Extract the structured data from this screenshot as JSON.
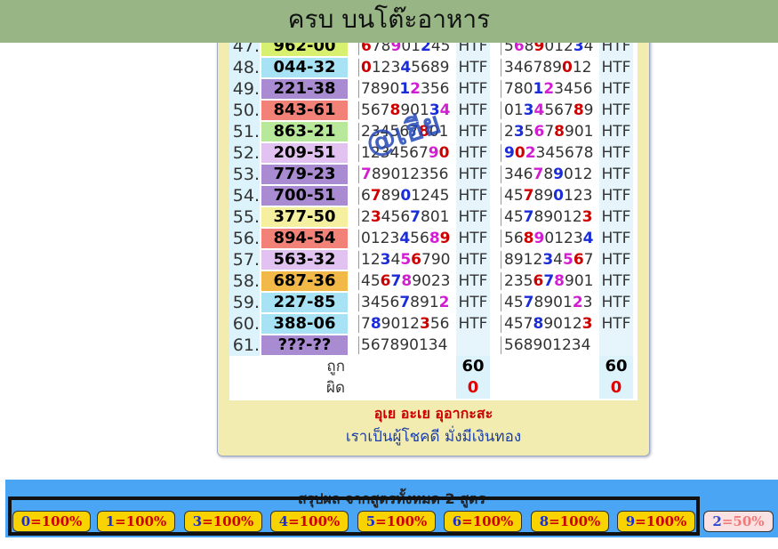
{
  "header": {
    "title": "ครบ บนโต๊ะอาหาร"
  },
  "watermark_text": "@เฮีย",
  "rows": [
    {
      "no": "47.",
      "num": "962-00",
      "bg": "#d8f070",
      "seq1": [
        [
          "6",
          "red"
        ],
        [
          "7",
          "g"
        ],
        [
          "8",
          "g"
        ],
        [
          "9",
          "pink"
        ],
        [
          "0",
          "g"
        ],
        [
          "1",
          "g"
        ],
        [
          "2",
          "blue"
        ],
        [
          "4",
          "g"
        ],
        [
          "5",
          "g"
        ]
      ],
      "htf1": "HTF",
      "seq2": [
        [
          "5",
          "g"
        ],
        [
          "6",
          "pink"
        ],
        [
          "8",
          "g"
        ],
        [
          "9",
          "red"
        ],
        [
          "0",
          "g"
        ],
        [
          "1",
          "g"
        ],
        [
          "2",
          "g"
        ],
        [
          "3",
          "blue"
        ],
        [
          "4",
          "g"
        ]
      ],
      "htf2": "HTF"
    },
    {
      "no": "48.",
      "num": "044-32",
      "bg": "#a7e3f5",
      "seq1": [
        [
          "0",
          "red"
        ],
        [
          "1",
          "g"
        ],
        [
          "2",
          "g"
        ],
        [
          "3",
          "g"
        ],
        [
          "4",
          "blue"
        ],
        [
          "5",
          "g"
        ],
        [
          "6",
          "g"
        ],
        [
          "8",
          "g"
        ],
        [
          "9",
          "g"
        ]
      ],
      "htf1": "HTF",
      "seq2": [
        [
          "3",
          "g"
        ],
        [
          "4",
          "g"
        ],
        [
          "6",
          "g"
        ],
        [
          "7",
          "g"
        ],
        [
          "8",
          "g"
        ],
        [
          "9",
          "g"
        ],
        [
          "0",
          "red"
        ],
        [
          "1",
          "g"
        ],
        [
          "2",
          "g"
        ]
      ],
      "htf2": "HTF"
    },
    {
      "no": "49.",
      "num": "221-38",
      "bg": "#a98bd2",
      "seq1": [
        [
          "7",
          "g"
        ],
        [
          "8",
          "g"
        ],
        [
          "9",
          "g"
        ],
        [
          "0",
          "g"
        ],
        [
          "1",
          "blue"
        ],
        [
          "2",
          "pink"
        ],
        [
          "3",
          "g"
        ],
        [
          "5",
          "g"
        ],
        [
          "6",
          "g"
        ]
      ],
      "htf1": "HTF",
      "seq2": [
        [
          "7",
          "g"
        ],
        [
          "8",
          "g"
        ],
        [
          "0",
          "g"
        ],
        [
          "1",
          "blue"
        ],
        [
          "2",
          "pink"
        ],
        [
          "3",
          "g"
        ],
        [
          "4",
          "g"
        ],
        [
          "5",
          "g"
        ],
        [
          "6",
          "g"
        ]
      ],
      "htf2": "HTF"
    },
    {
      "no": "50.",
      "num": "843-61",
      "bg": "#f28278",
      "seq1": [
        [
          "5",
          "g"
        ],
        [
          "6",
          "g"
        ],
        [
          "7",
          "g"
        ],
        [
          "8",
          "red"
        ],
        [
          "9",
          "g"
        ],
        [
          "0",
          "g"
        ],
        [
          "1",
          "g"
        ],
        [
          "3",
          "blue"
        ],
        [
          "4",
          "pink"
        ]
      ],
      "htf1": "HTF",
      "seq2": [
        [
          "0",
          "g"
        ],
        [
          "1",
          "g"
        ],
        [
          "3",
          "blue"
        ],
        [
          "4",
          "pink"
        ],
        [
          "5",
          "g"
        ],
        [
          "6",
          "g"
        ],
        [
          "7",
          "g"
        ],
        [
          "8",
          "red"
        ],
        [
          "9",
          "g"
        ]
      ],
      "htf2": "HTF"
    },
    {
      "no": "51.",
      "num": "863-21",
      "bg": "#b8e89a",
      "seq1": [
        [
          "2",
          "g"
        ],
        [
          "3",
          "g"
        ],
        [
          "4",
          "g"
        ],
        [
          "5",
          "g"
        ],
        [
          "6",
          "g"
        ],
        [
          "7",
          "g"
        ],
        [
          "8",
          "red"
        ],
        [
          "0",
          "g"
        ],
        [
          "1",
          "g"
        ]
      ],
      "htf1": "HTF",
      "seq2": [
        [
          "2",
          "g"
        ],
        [
          "3",
          "blue"
        ],
        [
          "5",
          "g"
        ],
        [
          "6",
          "pink"
        ],
        [
          "7",
          "g"
        ],
        [
          "8",
          "red"
        ],
        [
          "9",
          "g"
        ],
        [
          "0",
          "g"
        ],
        [
          "1",
          "g"
        ]
      ],
      "htf2": "HTF"
    },
    {
      "no": "52.",
      "num": "209-51",
      "bg": "#e2c2f0",
      "seq1": [
        [
          "1",
          "g"
        ],
        [
          "2",
          "g"
        ],
        [
          "3",
          "g"
        ],
        [
          "4",
          "g"
        ],
        [
          "5",
          "g"
        ],
        [
          "6",
          "g"
        ],
        [
          "7",
          "g"
        ],
        [
          "9",
          "pink"
        ],
        [
          "0",
          "red"
        ]
      ],
      "htf1": "HTF",
      "seq2": [
        [
          "9",
          "blue"
        ],
        [
          "0",
          "red"
        ],
        [
          "2",
          "pink"
        ],
        [
          "3",
          "g"
        ],
        [
          "4",
          "g"
        ],
        [
          "5",
          "g"
        ],
        [
          "6",
          "g"
        ],
        [
          "7",
          "g"
        ],
        [
          "8",
          "g"
        ]
      ],
      "htf2": "HTF"
    },
    {
      "no": "53.",
      "num": "779-23",
      "bg": "#a98bd2",
      "seq1": [
        [
          "7",
          "pink"
        ],
        [
          "8",
          "g"
        ],
        [
          "9",
          "g"
        ],
        [
          "0",
          "g"
        ],
        [
          "1",
          "g"
        ],
        [
          "2",
          "g"
        ],
        [
          "3",
          "g"
        ],
        [
          "5",
          "g"
        ],
        [
          "6",
          "g"
        ]
      ],
      "htf1": "HTF",
      "seq2": [
        [
          "3",
          "g"
        ],
        [
          "4",
          "g"
        ],
        [
          "6",
          "g"
        ],
        [
          "7",
          "pink"
        ],
        [
          "8",
          "g"
        ],
        [
          "9",
          "blue"
        ],
        [
          "0",
          "g"
        ],
        [
          "1",
          "g"
        ],
        [
          "2",
          "g"
        ]
      ],
      "htf2": "HTF"
    },
    {
      "no": "54.",
      "num": "700-51",
      "bg": "#a98bd2",
      "seq1": [
        [
          "6",
          "g"
        ],
        [
          "7",
          "red"
        ],
        [
          "8",
          "g"
        ],
        [
          "9",
          "g"
        ],
        [
          "0",
          "blue"
        ],
        [
          "1",
          "g"
        ],
        [
          "2",
          "g"
        ],
        [
          "4",
          "g"
        ],
        [
          "5",
          "g"
        ]
      ],
      "htf1": "HTF",
      "seq2": [
        [
          "4",
          "g"
        ],
        [
          "5",
          "g"
        ],
        [
          "7",
          "red"
        ],
        [
          "8",
          "g"
        ],
        [
          "9",
          "g"
        ],
        [
          "0",
          "blue"
        ],
        [
          "1",
          "g"
        ],
        [
          "2",
          "g"
        ],
        [
          "3",
          "g"
        ]
      ],
      "htf2": "HTF"
    },
    {
      "no": "55.",
      "num": "377-50",
      "bg": "#f5f0a0",
      "seq1": [
        [
          "2",
          "g"
        ],
        [
          "3",
          "red"
        ],
        [
          "4",
          "g"
        ],
        [
          "5",
          "g"
        ],
        [
          "6",
          "g"
        ],
        [
          "7",
          "blue"
        ],
        [
          "8",
          "g"
        ],
        [
          "0",
          "g"
        ],
        [
          "1",
          "g"
        ]
      ],
      "htf1": "HTF",
      "seq2": [
        [
          "4",
          "g"
        ],
        [
          "5",
          "g"
        ],
        [
          "7",
          "blue"
        ],
        [
          "8",
          "g"
        ],
        [
          "9",
          "g"
        ],
        [
          "0",
          "g"
        ],
        [
          "1",
          "g"
        ],
        [
          "2",
          "g"
        ],
        [
          "3",
          "red"
        ]
      ],
      "htf2": "HTF"
    },
    {
      "no": "56.",
      "num": "894-54",
      "bg": "#f28278",
      "seq1": [
        [
          "0",
          "g"
        ],
        [
          "1",
          "g"
        ],
        [
          "2",
          "g"
        ],
        [
          "3",
          "g"
        ],
        [
          "4",
          "blue"
        ],
        [
          "5",
          "g"
        ],
        [
          "6",
          "g"
        ],
        [
          "8",
          "pink"
        ],
        [
          "9",
          "red"
        ]
      ],
      "htf1": "HTF",
      "seq2": [
        [
          "5",
          "g"
        ],
        [
          "6",
          "g"
        ],
        [
          "8",
          "red"
        ],
        [
          "9",
          "pink"
        ],
        [
          "0",
          "g"
        ],
        [
          "1",
          "g"
        ],
        [
          "2",
          "g"
        ],
        [
          "3",
          "g"
        ],
        [
          "4",
          "blue"
        ]
      ],
      "htf2": "HTF"
    },
    {
      "no": "57.",
      "num": "563-32",
      "bg": "#e2c2f0",
      "seq1": [
        [
          "1",
          "g"
        ],
        [
          "2",
          "g"
        ],
        [
          "3",
          "blue"
        ],
        [
          "4",
          "g"
        ],
        [
          "5",
          "pink"
        ],
        [
          "6",
          "red"
        ],
        [
          "7",
          "g"
        ],
        [
          "9",
          "g"
        ],
        [
          "0",
          "g"
        ]
      ],
      "htf1": "HTF",
      "seq2": [
        [
          "8",
          "g"
        ],
        [
          "9",
          "g"
        ],
        [
          "1",
          "g"
        ],
        [
          "2",
          "g"
        ],
        [
          "3",
          "blue"
        ],
        [
          "4",
          "g"
        ],
        [
          "5",
          "pink"
        ],
        [
          "6",
          "red"
        ],
        [
          "7",
          "g"
        ]
      ],
      "htf2": "HTF"
    },
    {
      "no": "58.",
      "num": "687-36",
      "bg": "#f2b848",
      "seq1": [
        [
          "4",
          "g"
        ],
        [
          "5",
          "g"
        ],
        [
          "6",
          "red"
        ],
        [
          "7",
          "blue"
        ],
        [
          "8",
          "pink"
        ],
        [
          "9",
          "g"
        ],
        [
          "0",
          "g"
        ],
        [
          "2",
          "g"
        ],
        [
          "3",
          "g"
        ]
      ],
      "htf1": "HTF",
      "seq2": [
        [
          "2",
          "g"
        ],
        [
          "3",
          "g"
        ],
        [
          "5",
          "g"
        ],
        [
          "6",
          "red"
        ],
        [
          "7",
          "blue"
        ],
        [
          "8",
          "pink"
        ],
        [
          "9",
          "g"
        ],
        [
          "0",
          "g"
        ],
        [
          "1",
          "g"
        ]
      ],
      "htf2": "HTF"
    },
    {
      "no": "59.",
      "num": "227-85",
      "bg": "#a7e3f5",
      "seq1": [
        [
          "3",
          "g"
        ],
        [
          "4",
          "g"
        ],
        [
          "5",
          "g"
        ],
        [
          "6",
          "g"
        ],
        [
          "7",
          "blue"
        ],
        [
          "8",
          "g"
        ],
        [
          "9",
          "g"
        ],
        [
          "1",
          "g"
        ],
        [
          "2",
          "pink"
        ]
      ],
      "htf1": "HTF",
      "seq2": [
        [
          "4",
          "g"
        ],
        [
          "5",
          "g"
        ],
        [
          "7",
          "blue"
        ],
        [
          "8",
          "g"
        ],
        [
          "9",
          "g"
        ],
        [
          "0",
          "g"
        ],
        [
          "1",
          "g"
        ],
        [
          "2",
          "pink"
        ],
        [
          "3",
          "g"
        ]
      ],
      "htf2": "HTF"
    },
    {
      "no": "60.",
      "num": "388-06",
      "bg": "#a7e3f5",
      "seq1": [
        [
          "7",
          "g"
        ],
        [
          "8",
          "blue"
        ],
        [
          "9",
          "g"
        ],
        [
          "0",
          "g"
        ],
        [
          "1",
          "g"
        ],
        [
          "2",
          "g"
        ],
        [
          "3",
          "red"
        ],
        [
          "5",
          "g"
        ],
        [
          "6",
          "g"
        ]
      ],
      "htf1": "HTF",
      "seq2": [
        [
          "4",
          "g"
        ],
        [
          "5",
          "g"
        ],
        [
          "7",
          "g"
        ],
        [
          "8",
          "blue"
        ],
        [
          "9",
          "g"
        ],
        [
          "0",
          "g"
        ],
        [
          "1",
          "g"
        ],
        [
          "2",
          "g"
        ],
        [
          "3",
          "red"
        ]
      ],
      "htf2": "HTF"
    },
    {
      "no": "61.",
      "num": "???-??",
      "bg": "#a98bd2",
      "seq1": [
        [
          "5",
          "g"
        ],
        [
          "6",
          "g"
        ],
        [
          "7",
          "g"
        ],
        [
          "8",
          "g"
        ],
        [
          "9",
          "g"
        ],
        [
          "0",
          "g"
        ],
        [
          "1",
          "g"
        ],
        [
          "3",
          "g"
        ],
        [
          "4",
          "g"
        ]
      ],
      "htf1": "",
      "seq2": [
        [
          "5",
          "g"
        ],
        [
          "6",
          "g"
        ],
        [
          "8",
          "g"
        ],
        [
          "9",
          "g"
        ],
        [
          "0",
          "g"
        ],
        [
          "1",
          "g"
        ],
        [
          "2",
          "g"
        ],
        [
          "3",
          "g"
        ],
        [
          "4",
          "g"
        ]
      ],
      "htf2": ""
    }
  ],
  "totals": {
    "correct_label": "ถูก",
    "wrong_label": "ผิด",
    "correct_1": "60",
    "correct_2": "60",
    "wrong_1": "0",
    "wrong_2": "0"
  },
  "motto": {
    "line1": "อุเย อะเย อุอากะสะ",
    "line2": "เราเป็นผู้โชคดี มั่งมีเงินทอง"
  },
  "summary": {
    "title": "สรุปผล จากสูตรทั้งหมด 2 สูตร",
    "badges": [
      {
        "num": "0",
        "pct": "=100%",
        "pale": false
      },
      {
        "num": "1",
        "pct": "=100%",
        "pale": false
      },
      {
        "num": "3",
        "pct": "=100%",
        "pale": false
      },
      {
        "num": "4",
        "pct": "=100%",
        "pale": false
      },
      {
        "num": "5",
        "pct": "=100%",
        "pale": false
      },
      {
        "num": "6",
        "pct": "=100%",
        "pale": false
      },
      {
        "num": "8",
        "pct": "=100%",
        "pale": false
      },
      {
        "num": "9",
        "pct": "=100%",
        "pale": false
      },
      {
        "num": "2",
        "pct": "=50%",
        "pale": true
      }
    ]
  },
  "colors": {
    "banner": "#97b585",
    "panel": "#f2ecb0",
    "summary_bar": "#4aa6f5",
    "badge": "#f8d300",
    "red": "#cc0000",
    "blue": "#1b2dd6",
    "pink": "#d21ed2",
    "gray": "#333333"
  }
}
